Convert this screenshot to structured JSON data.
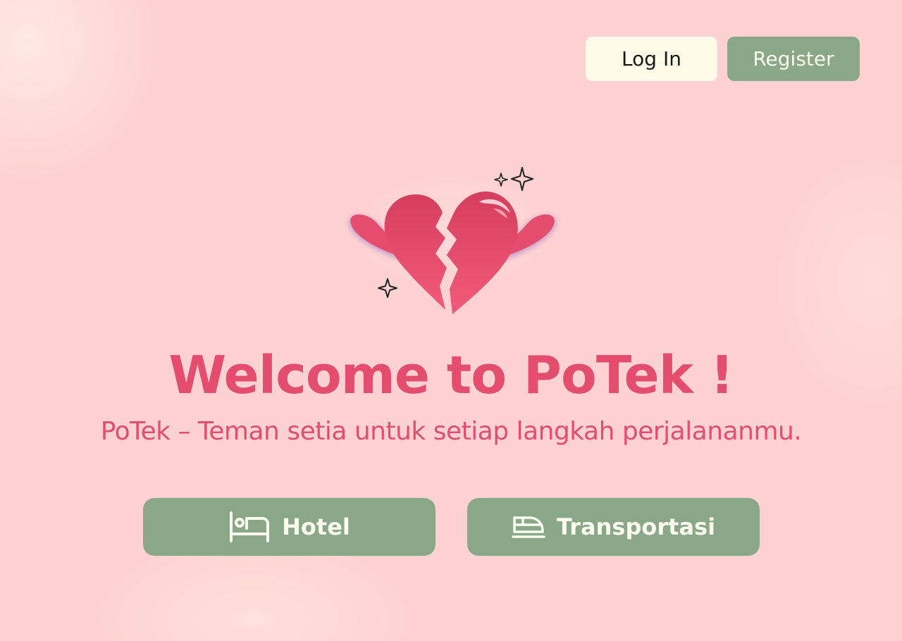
{
  "header": {
    "login_label": "Log In",
    "register_label": "Register"
  },
  "hero": {
    "title": "Welcome to PoTek !",
    "subtitle": "PoTek – Teman setia untuk setiap langkah perjalananmu."
  },
  "services": [
    {
      "label": "Hotel",
      "icon": "bed-icon"
    },
    {
      "label": "Transportasi",
      "icon": "train-icon"
    }
  ],
  "colors": {
    "background": "#fed2d2",
    "accent": "#e44d6d",
    "button_green": "#8aa888",
    "button_cream": "#fffbe8"
  }
}
